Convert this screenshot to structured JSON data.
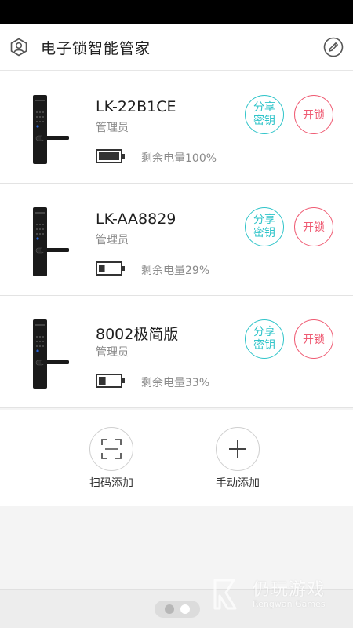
{
  "header": {
    "title": "电子锁智能管家"
  },
  "locks": [
    {
      "name": "LK-22B1CE",
      "role": "管理员",
      "battery_text": "剩余电量100%",
      "battery_level": 100,
      "share_label_1": "分享",
      "share_label_2": "密钥",
      "unlock_label": "开锁"
    },
    {
      "name": "LK-AA8829",
      "role": "管理员",
      "battery_text": "剩余电量29%",
      "battery_level": 29,
      "share_label_1": "分享",
      "share_label_2": "密钥",
      "unlock_label": "开锁"
    },
    {
      "name": "8002极简版",
      "role": "管理员",
      "battery_text": "剩余电量33%",
      "battery_level": 33,
      "share_label_1": "分享",
      "share_label_2": "密钥",
      "unlock_label": "开锁"
    }
  ],
  "add_panel": {
    "scan_label": "扫码添加",
    "manual_label": "手动添加"
  },
  "watermark": {
    "title": "仍玩游戏",
    "subtitle": "Rengwan Games"
  },
  "colors": {
    "share_accent": "#2fc4c9",
    "unlock_accent": "#ef5b73"
  }
}
